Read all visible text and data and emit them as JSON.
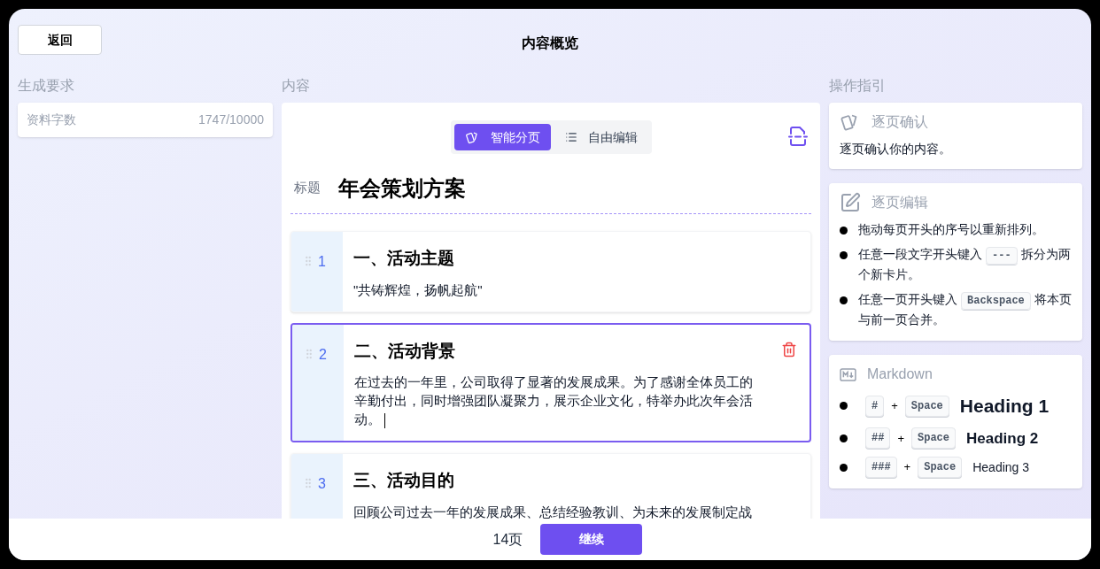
{
  "header": {
    "back_button": "返回",
    "title": "内容概览"
  },
  "requirements": {
    "label": "生成要求",
    "rows": [
      {
        "label": "资料字数",
        "value": "1747/10000"
      }
    ]
  },
  "content": {
    "label": "内容",
    "modes": [
      {
        "kind": "cards",
        "label": "智能分页",
        "selected": true
      },
      {
        "kind": "list",
        "label": "自由编辑",
        "selected": false
      }
    ],
    "title_label": "标题",
    "title": "年会策划方案",
    "pages": [
      {
        "number": "1",
        "heading": "一、活动主题",
        "body": "\"共铸辉煌，扬帆起航\"",
        "selected": false
      },
      {
        "number": "2",
        "heading": "二、活动背景",
        "body": "在过去的一年里，公司取得了显著的发展成果。为了感谢全体员工的辛勤付出，同时增强团队凝聚力，展示企业文化，特举办此次年会活动。",
        "selected": true
      },
      {
        "number": "3",
        "heading": "三、活动目的",
        "body": "回顾公司过去一年的发展成果、总结经验教训、为未来的发展制定战",
        "selected": false
      }
    ]
  },
  "guide": {
    "label": "操作指引",
    "cards": [
      {
        "kind": "text",
        "title": "逐页确认",
        "text": "逐页确认你的内容。"
      },
      {
        "kind": "list",
        "title": "逐页编辑",
        "items": [
          [
            {
              "kind": "text",
              "text": "拖动每页开头的序号以重新排列。"
            }
          ],
          [
            {
              "kind": "text",
              "text": "任意一段文字开头键入"
            },
            {
              "kind": "kbd",
              "text": "---"
            },
            {
              "kind": "text",
              "text": "拆分为两个新卡片。"
            }
          ],
          [
            {
              "kind": "text",
              "text": "任意一页开头键入"
            },
            {
              "kind": "kbd",
              "text": "Backspace"
            },
            {
              "kind": "text",
              "text": "将本页与前一页合并。"
            }
          ]
        ]
      },
      {
        "kind": "markdown",
        "title": "Markdown",
        "items": [
          {
            "key": "#",
            "plus": "+",
            "key2": "Space",
            "example": "Heading 1",
            "kind": "h1"
          },
          {
            "key": "##",
            "plus": "+",
            "key2": "Space",
            "example": "Heading 2",
            "kind": "h2"
          },
          {
            "key": "###",
            "plus": "+",
            "key2": "Space",
            "example": "Heading 3",
            "kind": "h3"
          }
        ]
      }
    ]
  },
  "footer": {
    "page_count": "14页",
    "continue_button": "继续"
  }
}
